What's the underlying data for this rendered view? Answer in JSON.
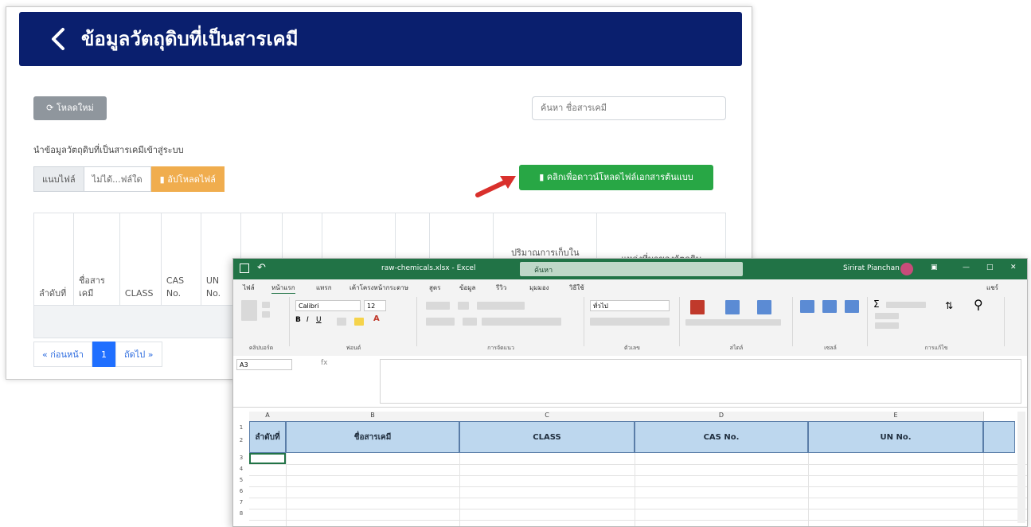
{
  "web": {
    "title": "ข้อมูลวัตถุดิบที่เป็นสารเคมี",
    "reload_label": "⟳ โหลดใหม่",
    "search_placeholder": "ค้นหา ชื่อสารเคมี",
    "import_label": "นำข้อมูลวัตถุดิบที่เป็นสารเคมีเข้าสู่ระบบ",
    "file_choose": "แนบไฟล์",
    "file_name": "ไม่ได้...ฟล์ใด",
    "upload_label": "อัปโหลดไฟล์",
    "download_template_label": "คลิกเพื่อดาวน์โหลดไฟล์เอกสารต้นแบบ",
    "table_headers": [
      "ลำดับที่",
      "ชื่อสารเคมี",
      "CLASS",
      "CAS No.",
      "UN No.",
      "",
      "",
      "",
      "",
      "",
      "ปริมาณการเก็บในโรงงาน",
      "แหล่งที่มาของวัตถุดิบ"
    ],
    "pager": {
      "prev": "« ก่อนหน้า",
      "current": "1",
      "next": "ถัดไป »"
    }
  },
  "excel": {
    "title": "raw-chemicals.xlsx - Excel",
    "search_placeholder": "ค้นหา",
    "user_name": "Sirirat Pianchan",
    "tabs": [
      "ไฟล์",
      "หน้าแรก",
      "แทรก",
      "เค้าโครงหน้ากระดาษ",
      "สูตร",
      "ข้อมูล",
      "รีวิว",
      "มุมมอง",
      "วิธีใช้"
    ],
    "share_label": "แชร์",
    "font_name": "Calibri",
    "font_size": "12",
    "number_format": "ทั่วไป",
    "ribbon_groups": [
      "คลิปบอร์ด",
      "ฟอนต์",
      "การจัดแนว",
      "ตัวเลข",
      "สไตล์",
      "เซลล์",
      "การแก้ไข"
    ],
    "name_box": "A3",
    "columns": [
      "A",
      "B",
      "C",
      "D",
      "E"
    ],
    "headers": [
      "ลำดับที่",
      "ชื่อสารเคมี",
      "CLASS",
      "CAS No.",
      "UN No."
    ],
    "rows": [
      "1",
      "2",
      "3",
      "4",
      "5",
      "6",
      "7",
      "8"
    ]
  }
}
